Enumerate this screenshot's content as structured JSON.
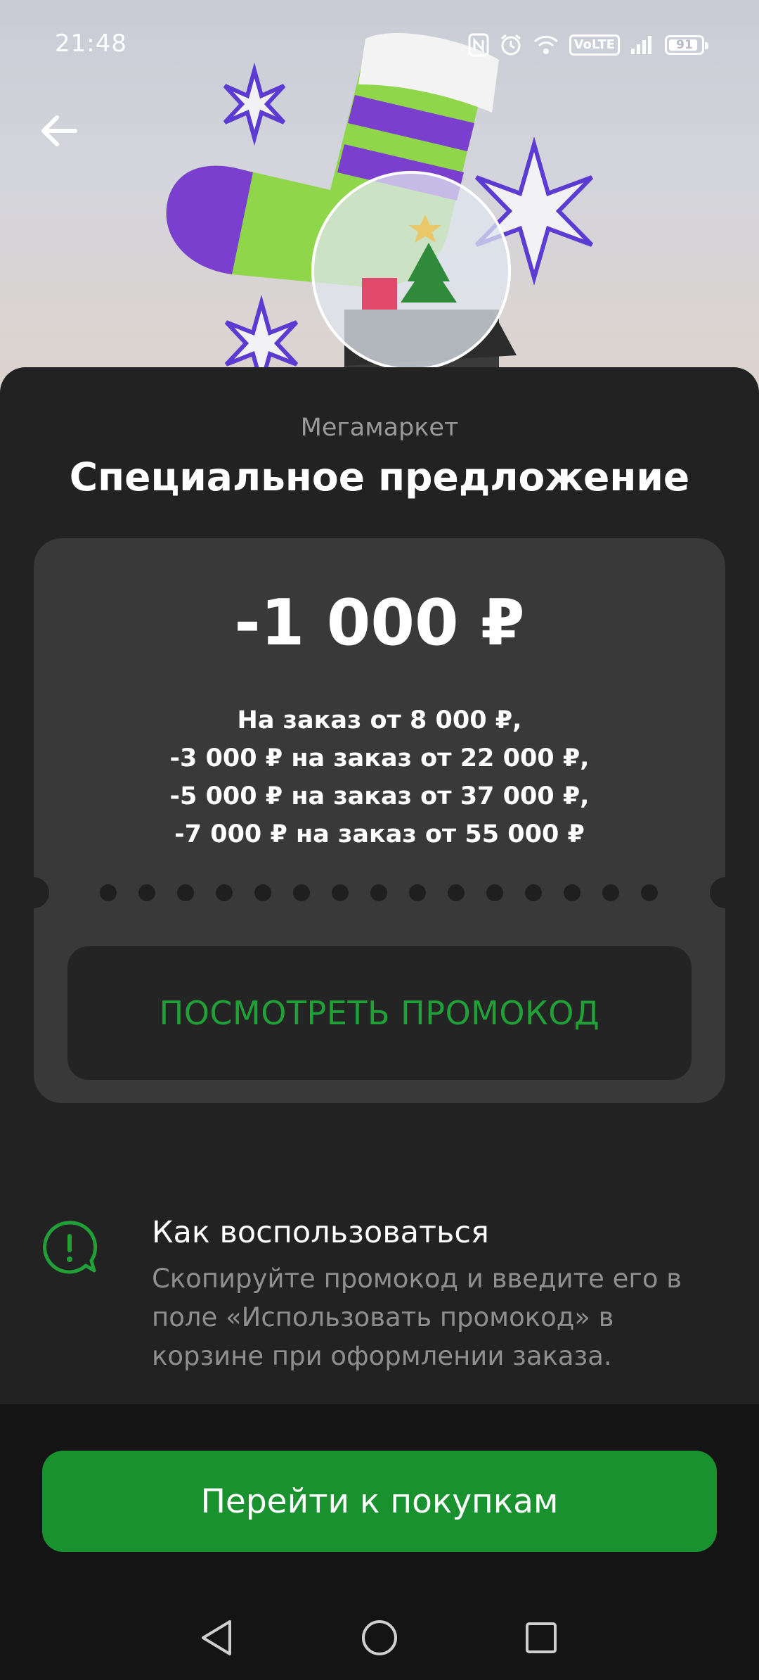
{
  "status_bar": {
    "time": "21:48",
    "network": "VoLTE",
    "battery": "91",
    "icons": [
      "nfc-icon",
      "alarm-icon",
      "wifi-icon",
      "volte-icon",
      "signal-icon",
      "battery-icon"
    ]
  },
  "header": {
    "back_icon": "arrow-left-icon"
  },
  "offer": {
    "merchant": "Мегамаркет",
    "title": "Специальное предложение",
    "amount": "-1 000 ₽",
    "conditions": [
      "На заказ от 8 000 ₽,",
      "-3 000 ₽ на заказ от 22 000 ₽,",
      "-5 000 ₽ на заказ от 37 000 ₽,",
      "-7 000 ₽ на заказ от 55 000 ₽"
    ],
    "promo_button_label": "ПОСМОТРЕТЬ ПРОМОКОД"
  },
  "howto": {
    "icon": "message-alert-icon",
    "title": "Как воспользоваться",
    "text": "Скопируйте промокод и введите его в поле «Использовать промокод» в корзине при оформлении заказа."
  },
  "cta": {
    "label": "Перейти к покупкам"
  },
  "nav_bar": {
    "icons": [
      "back-triangle-icon",
      "home-circle-icon",
      "recents-square-icon"
    ]
  },
  "colors": {
    "accent_green": "#21a038",
    "button_green": "#1a912f",
    "sheet_bg": "#222222",
    "card_bg": "#393939"
  }
}
